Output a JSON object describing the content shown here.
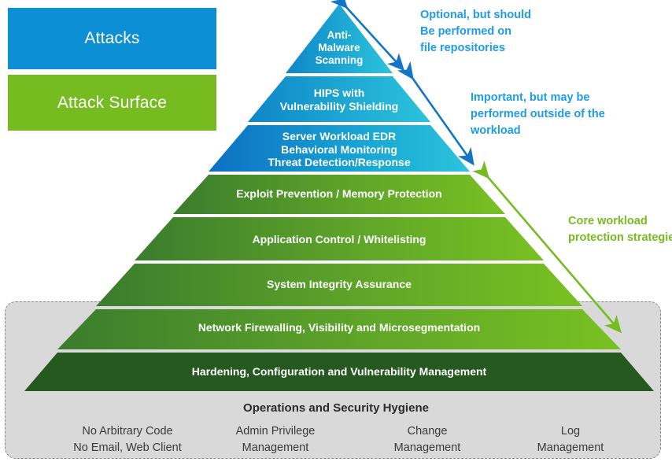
{
  "legend": {
    "attacks": {
      "label": "Attacks",
      "color": "#0C8FD5"
    },
    "attack_surface": {
      "label": "Attack Surface",
      "color": "#76BC21"
    }
  },
  "pyramid": {
    "layers": [
      {
        "id": "anti-malware-scanning",
        "lines": [
          "Anti-",
          "Malware",
          "Scanning"
        ],
        "band": "attacks",
        "color_left": "#0E86C8",
        "color_right": "#2BC4DC"
      },
      {
        "id": "hips-vulnerability-shielding",
        "lines": [
          "HIPS with",
          "Vulnerability Shielding"
        ],
        "band": "attacks",
        "color_left": "#0E86C8",
        "color_right": "#2BC4DC"
      },
      {
        "id": "server-workload-edr",
        "lines": [
          "Server Workload EDR",
          "Behavioral Monitoring",
          "Threat Detection/Response"
        ],
        "band": "attacks",
        "color_left": "#0E6FC0",
        "color_right": "#2BC4DC"
      },
      {
        "id": "exploit-prevention",
        "lines": [
          "Exploit Prevention  / Memory Protection"
        ],
        "band": "attack_surface",
        "color_left": "#3C7D2E",
        "color_right": "#76BC21"
      },
      {
        "id": "application-control",
        "lines": [
          "Application Control / Whitelisting"
        ],
        "band": "attack_surface",
        "color_left": "#3C7D2E",
        "color_right": "#76BC21"
      },
      {
        "id": "system-integrity-assurance",
        "lines": [
          "System Integrity Assurance"
        ],
        "band": "attack_surface",
        "color_left": "#3C7D2E",
        "color_right": "#76BC21"
      },
      {
        "id": "network-firewalling",
        "lines": [
          "Network Firewalling, Visibility and Microsegmentation"
        ],
        "band": "attack_surface",
        "color_left": "#3C7D2E",
        "color_right": "#76BC21"
      },
      {
        "id": "hardening-configuration",
        "lines": [
          "Hardening, Configuration and Vulnerability Management"
        ],
        "band": "attack_surface",
        "color_left": "#26591F",
        "color_right": "#26591F"
      }
    ]
  },
  "callouts": [
    {
      "id": "optional-file-repositories",
      "color": "#1E9CE8",
      "lines": [
        "Optional, but should",
        "Be performed on",
        "file repositories"
      ]
    },
    {
      "id": "important-outside-workload",
      "color": "#1E9CE8",
      "lines": [
        "Important, but may be",
        "performed outside of the",
        "workload"
      ]
    },
    {
      "id": "core-workload-protection",
      "color": "#76BC21",
      "lines": [
        "Core workload",
        "protection strategies"
      ]
    }
  ],
  "operations": {
    "title": "Operations and Security Hygiene",
    "columns": [
      {
        "id": "no-arbitrary-code",
        "lines": [
          "No Arbitrary Code",
          "No Email, Web Client"
        ]
      },
      {
        "id": "admin-privilege-management",
        "lines": [
          "Admin Privilege",
          "Management"
        ]
      },
      {
        "id": "change-management",
        "lines": [
          "Change",
          "Management"
        ]
      },
      {
        "id": "log-management",
        "lines": [
          "Log",
          "Management"
        ]
      }
    ]
  }
}
